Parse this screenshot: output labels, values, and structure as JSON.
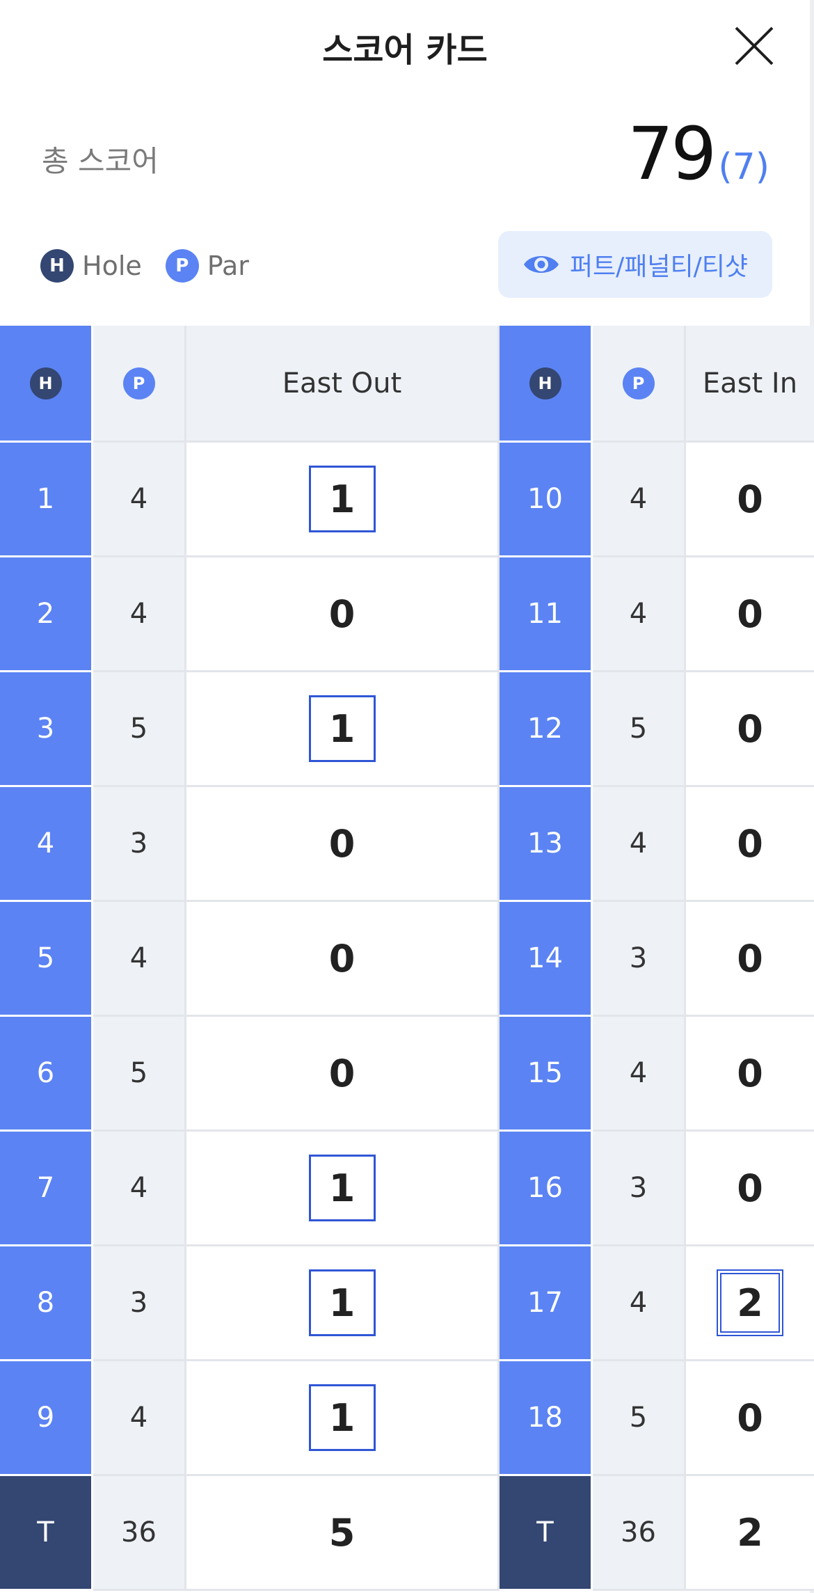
{
  "header": {
    "title": "스코어 카드",
    "close_icon": "close-icon"
  },
  "summary": {
    "label": "총 스코어",
    "score": "79",
    "sub": "(7)"
  },
  "legend": {
    "hole_badge": "H",
    "hole_label": "Hole",
    "par_badge": "P",
    "par_label": "Par"
  },
  "toggle": {
    "label": "퍼트/패널티/티샷",
    "icon": "eye-icon"
  },
  "colors": {
    "accent": "#5b83f3",
    "dark": "#344672",
    "par_bg": "#eef2f7",
    "box_border": "#2f56d6",
    "link": "#4f7ff0"
  },
  "table": {
    "headers": {
      "hole": "H",
      "par": "P",
      "out": "East Out",
      "in": "East In"
    },
    "out_rows": [
      {
        "hole": "1",
        "par": "4",
        "score": "1",
        "mark": "box"
      },
      {
        "hole": "2",
        "par": "4",
        "score": "0",
        "mark": ""
      },
      {
        "hole": "3",
        "par": "5",
        "score": "1",
        "mark": "box"
      },
      {
        "hole": "4",
        "par": "3",
        "score": "0",
        "mark": ""
      },
      {
        "hole": "5",
        "par": "4",
        "score": "0",
        "mark": ""
      },
      {
        "hole": "6",
        "par": "5",
        "score": "0",
        "mark": ""
      },
      {
        "hole": "7",
        "par": "4",
        "score": "1",
        "mark": "box"
      },
      {
        "hole": "8",
        "par": "3",
        "score": "1",
        "mark": "box"
      },
      {
        "hole": "9",
        "par": "4",
        "score": "1",
        "mark": "box"
      }
    ],
    "in_rows": [
      {
        "hole": "10",
        "par": "4",
        "score": "0",
        "mark": ""
      },
      {
        "hole": "11",
        "par": "4",
        "score": "0",
        "mark": ""
      },
      {
        "hole": "12",
        "par": "5",
        "score": "0",
        "mark": ""
      },
      {
        "hole": "13",
        "par": "4",
        "score": "0",
        "mark": ""
      },
      {
        "hole": "14",
        "par": "3",
        "score": "0",
        "mark": ""
      },
      {
        "hole": "15",
        "par": "4",
        "score": "0",
        "mark": ""
      },
      {
        "hole": "16",
        "par": "3",
        "score": "0",
        "mark": ""
      },
      {
        "hole": "17",
        "par": "4",
        "score": "2",
        "mark": "double-box"
      },
      {
        "hole": "18",
        "par": "5",
        "score": "0",
        "mark": ""
      }
    ],
    "totals": {
      "out": {
        "label": "T",
        "par": "36",
        "score": "5"
      },
      "in": {
        "label": "T",
        "par": "36",
        "score": "2"
      }
    }
  }
}
